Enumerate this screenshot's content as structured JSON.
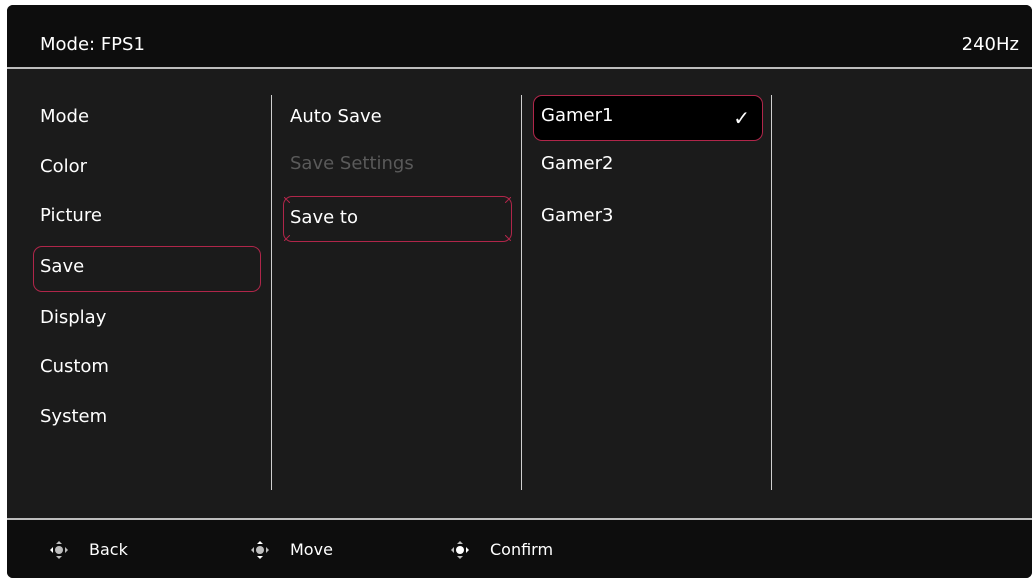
{
  "header": {
    "mode_label": "Mode: FPS1",
    "refresh_rate": "240Hz"
  },
  "menu": {
    "level1": [
      "Mode",
      "Color",
      "Picture",
      "Save",
      "Display",
      "Custom",
      "System"
    ],
    "level1_selected": "Save",
    "level2": [
      {
        "label": "Auto Save",
        "enabled": true
      },
      {
        "label": "Save Settings",
        "enabled": false
      },
      {
        "label": "Save to",
        "enabled": true
      }
    ],
    "level2_selected": "Save to",
    "level3": [
      "Gamer1",
      "Gamer2",
      "Gamer3"
    ],
    "level3_selected": "Gamer1",
    "check_glyph": "✓"
  },
  "footer": {
    "back_label": "Back",
    "move_label": "Move",
    "confirm_label": "Confirm",
    "icon": "joystick-icon"
  },
  "colors": {
    "background": "#1b1b1b",
    "highlight_border": "#b0264a",
    "text": "#ffffff",
    "disabled_text": "#5a5a5a"
  }
}
